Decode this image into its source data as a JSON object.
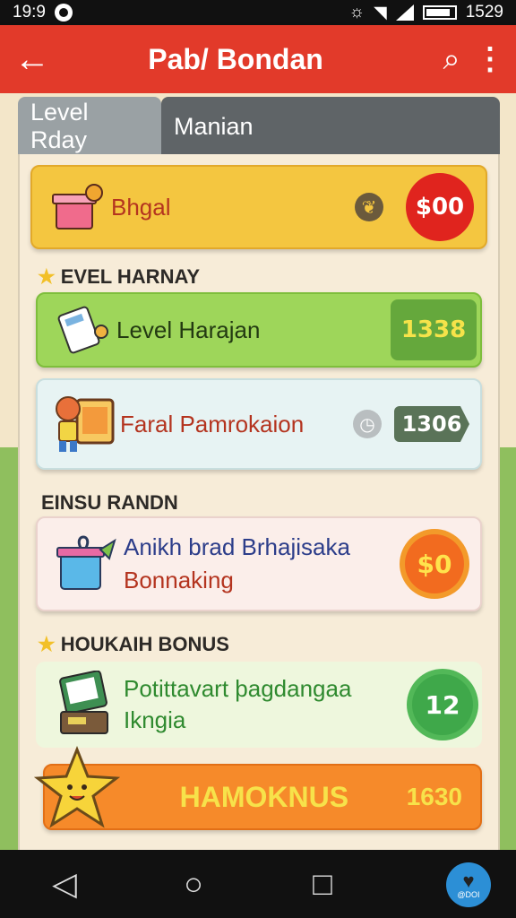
{
  "status": {
    "time_left": "19:9",
    "time_right": "1529"
  },
  "app_bar": {
    "title": "Pab/ Bondan"
  },
  "tabs": [
    {
      "label": "Level Rday"
    },
    {
      "label": "Manian"
    }
  ],
  "cards": {
    "top": {
      "label": "Bhgal",
      "badge": "$00",
      "color": "#f4c640"
    },
    "level_harajan": {
      "label": "Level Harajan",
      "badge": "1338",
      "color": "#9ed65a"
    },
    "faral": {
      "label": "Faral Pamrokaion",
      "badge": "1306",
      "color": "#e7f3f3"
    },
    "anikh": {
      "line1": "Anikh brad Brhajisaka",
      "line2": "Bonnaking",
      "badge": "$0",
      "color": "#fbeeea"
    },
    "potittawart": {
      "line1": "Potittavart þagdangaa",
      "line2": "Ikngia",
      "badge": "12",
      "color": "#eef7dd"
    },
    "hamoknus": {
      "label": "HAMOKNUS",
      "badge": "1630",
      "color": "#f68a2a"
    }
  },
  "sections": {
    "evel_harnay": "EVEL HARNAY",
    "einsu_randn": "EINSU RANDN",
    "houkaih_bonus": "HOUKAIH BONUS"
  },
  "fab": {
    "label": "@DOI"
  }
}
